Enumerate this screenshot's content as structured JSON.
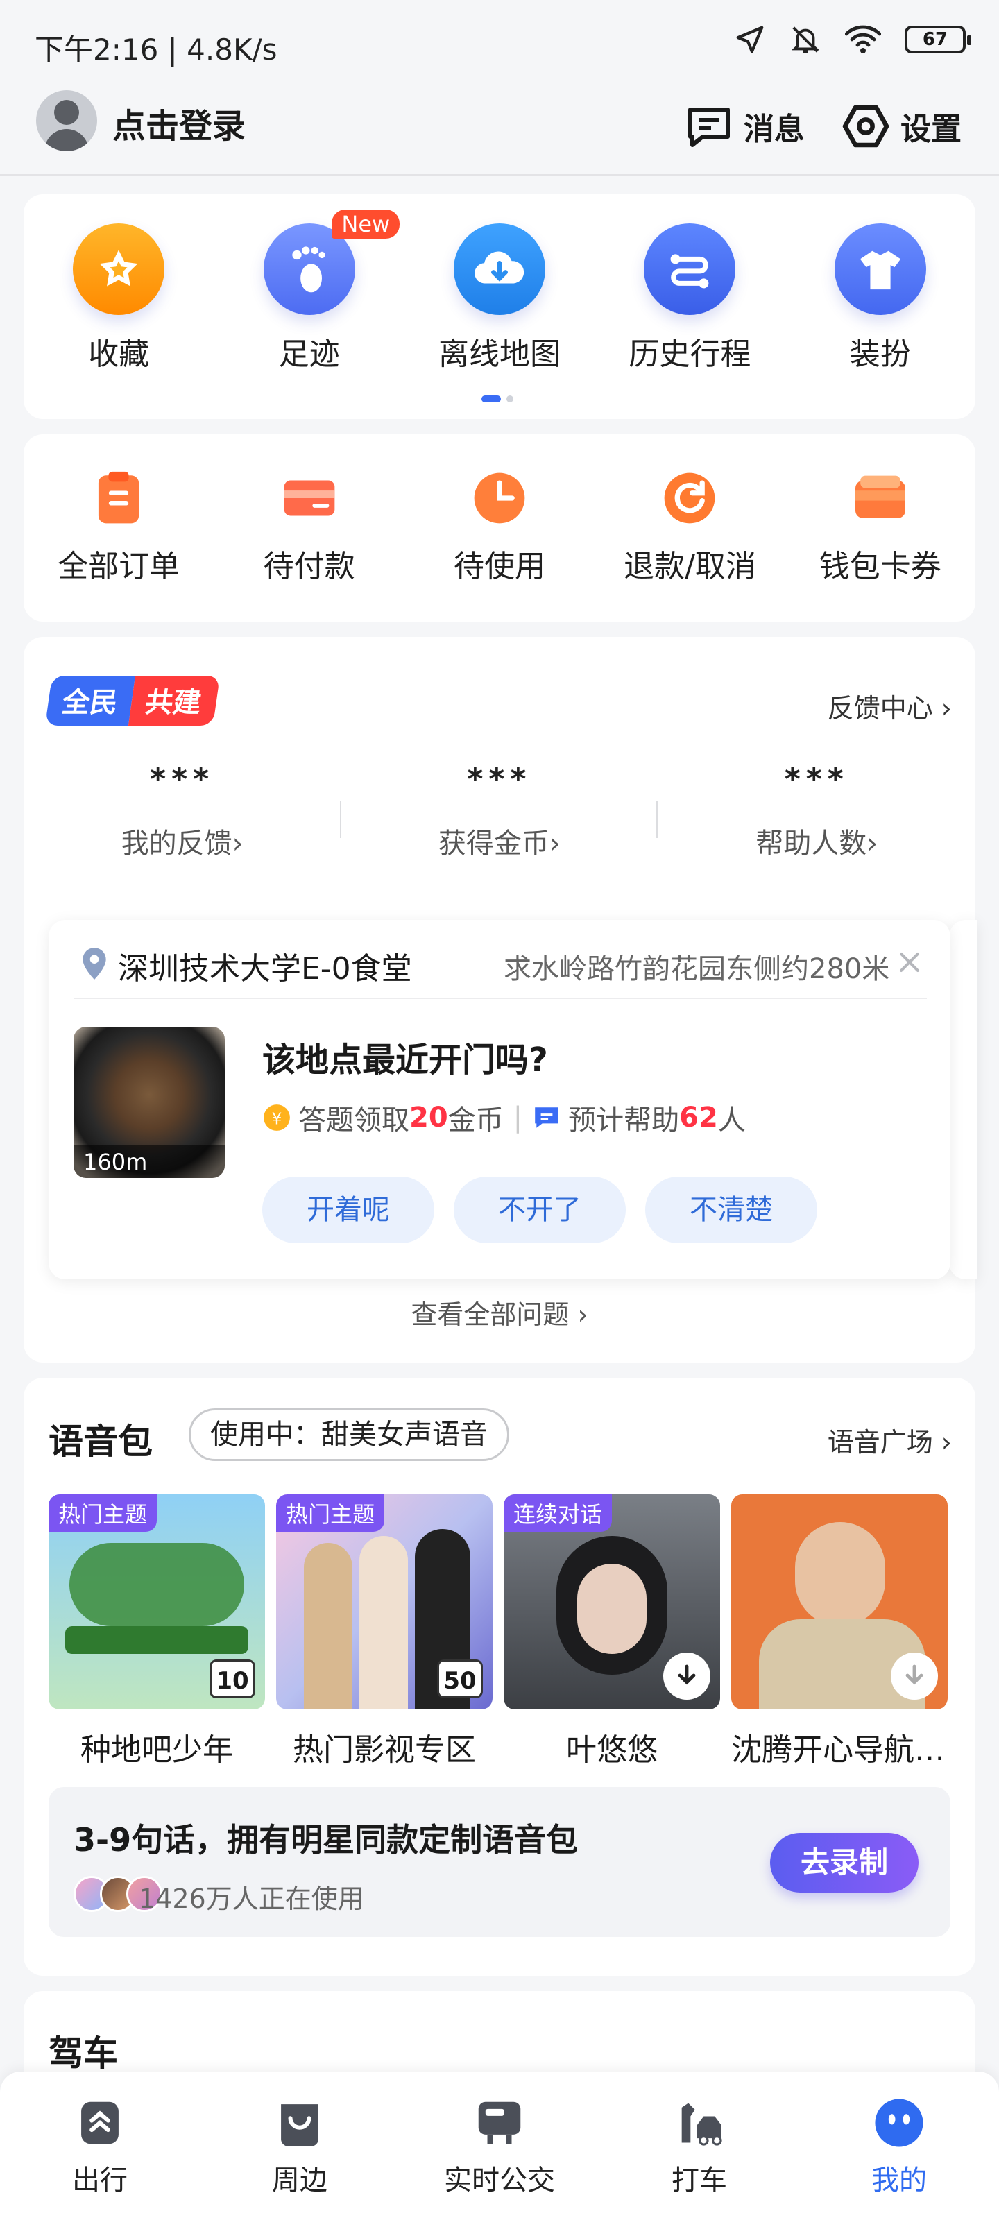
{
  "status_bar": {
    "time": "下午2:16 | 4.8K/s",
    "battery": "67"
  },
  "header": {
    "login_text": "点击登录",
    "messages_label": "消息",
    "settings_label": "设置"
  },
  "tools": [
    {
      "label": "收藏",
      "icon": "star-icon",
      "color": "#ff9a1a"
    },
    {
      "label": "足迹",
      "icon": "footprint-icon",
      "color": "#5b7cf7",
      "badge": "New"
    },
    {
      "label": "离线地图",
      "icon": "cloud-download-icon",
      "color": "#2c8ff2"
    },
    {
      "label": "历史行程",
      "icon": "route-icon",
      "color": "#4a6cf5"
    },
    {
      "label": "装扮",
      "icon": "shirt-icon",
      "color": "#4f74f6"
    }
  ],
  "orders": [
    {
      "label": "全部订单",
      "icon": "clipboard-icon"
    },
    {
      "label": "待付款",
      "icon": "card-icon"
    },
    {
      "label": "待使用",
      "icon": "clock-icon"
    },
    {
      "label": "退款/取消",
      "icon": "refresh-icon"
    },
    {
      "label": "钱包卡券",
      "icon": "wallet-icon"
    }
  ],
  "cobuild": {
    "badge_a": "全民",
    "badge_b": "共建",
    "feedback_center": "反馈中心",
    "stats": [
      {
        "value": "***",
        "label": "我的反馈"
      },
      {
        "value": "***",
        "label": "获得金币"
      },
      {
        "value": "***",
        "label": "帮助人数"
      }
    ],
    "question": {
      "place": "深圳技术大学E-0食堂",
      "address": "求水岭路竹韵花园东侧约280米",
      "distance": "160m",
      "title": "该地点最近开门吗?",
      "reward_prefix": "答题领取",
      "reward_amount": "20",
      "reward_suffix": "金币",
      "help_prefix": "预计帮助",
      "help_count": "62",
      "help_suffix": "人",
      "answers": [
        "开着呢",
        "不开了",
        "不清楚"
      ]
    },
    "see_all": "查看全部问题"
  },
  "voice": {
    "title": "语音包",
    "using": "使用中：甜美女声语音",
    "plaza": "语音广场",
    "packs": [
      {
        "name": "种地吧少年",
        "tag": "热门主题",
        "count": "10"
      },
      {
        "name": "热门影视专区",
        "tag": "热门主题",
        "count": "50"
      },
      {
        "name": "叶悠悠",
        "tag": "连续对话"
      },
      {
        "name": "沈腾开心导航语音"
      }
    ],
    "record": {
      "title": "3-9句话，拥有明星同款定制语音包",
      "users": "1426万人正在使用",
      "button": "去录制"
    }
  },
  "driving": {
    "title": "驾车"
  },
  "nav": [
    {
      "label": "出行",
      "icon": "travel-icon"
    },
    {
      "label": "周边",
      "icon": "nearby-icon"
    },
    {
      "label": "实时公交",
      "icon": "bus-icon"
    },
    {
      "label": "打车",
      "icon": "taxi-icon"
    },
    {
      "label": "我的",
      "icon": "profile-icon",
      "active": true
    }
  ]
}
